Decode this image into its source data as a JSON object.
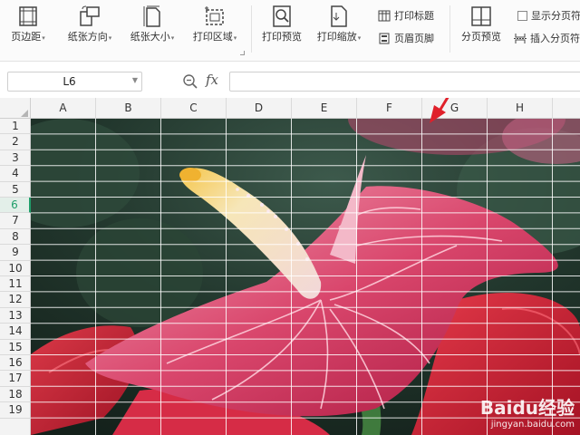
{
  "ribbon": {
    "margins": "页边距",
    "orientation": "纸张方向",
    "paper_size": "纸张大小",
    "print_area": "打印区域",
    "print_preview": "打印预览",
    "print_scale": "打印缩放",
    "print_titles": "打印标题",
    "header_footer": "页眉页脚",
    "page_break_preview": "分页预览",
    "show_page_breaks": "显示分页符",
    "insert_page_break": "插入分页符"
  },
  "formula_bar": {
    "cell_ref": "L6",
    "fx_label": "fx",
    "formula": ""
  },
  "sheet": {
    "columns": [
      "A",
      "B",
      "C",
      "D",
      "E",
      "F",
      "G",
      "H"
    ],
    "rows": [
      "1",
      "2",
      "3",
      "4",
      "5",
      "6",
      "7",
      "8",
      "9",
      "10",
      "11",
      "12",
      "13",
      "14",
      "15",
      "16",
      "17",
      "18",
      "19"
    ],
    "active_row": "6",
    "accent_color": "#1f9e6a"
  },
  "image": {
    "subject": "red-anthurium-flower-photo"
  },
  "watermark": {
    "brand": "Baidu经验",
    "site": "jingyan.baidu.com"
  },
  "annotation": {
    "arrow_color": "#e0202a"
  }
}
